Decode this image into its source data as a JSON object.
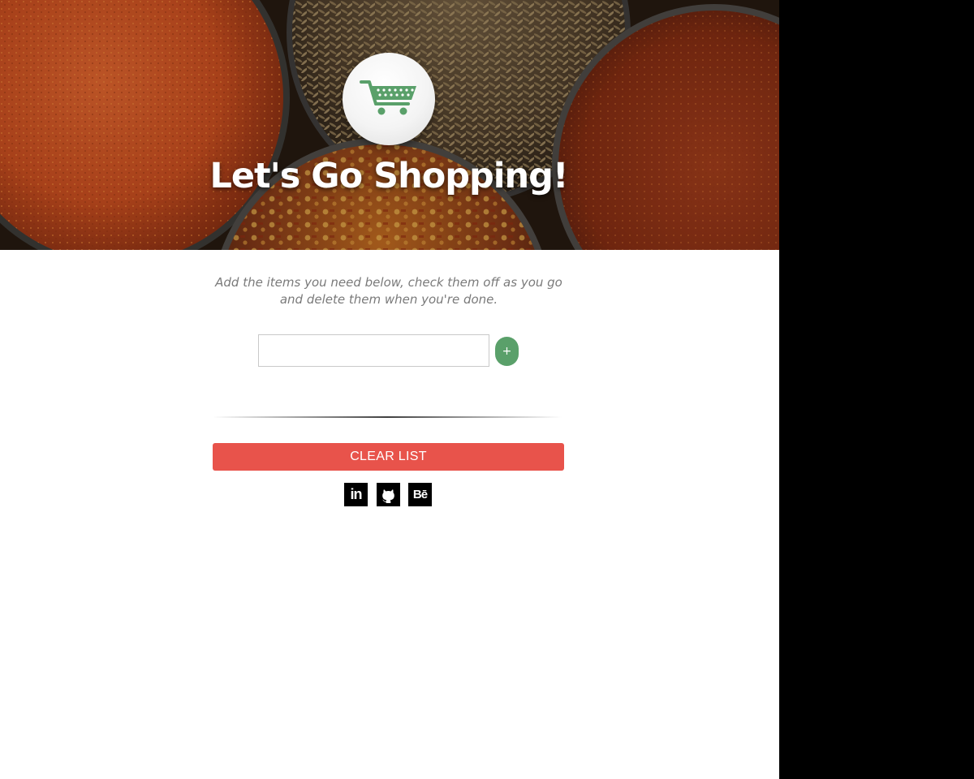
{
  "header": {
    "title": "Let's Go Shopping!",
    "logo_icon": "shopping-cart-icon",
    "logo_color": "#5aa06a"
  },
  "main": {
    "intro": "Add the items you need below, check them off as you go and delete them when you're done.",
    "item_input": {
      "value": "",
      "placeholder": ""
    },
    "add_button_label": "+",
    "clear_button_label": "CLEAR LIST"
  },
  "footer": {
    "social_links": [
      {
        "icon": "linkedin-icon",
        "label": "in"
      },
      {
        "icon": "github-icon",
        "label": ""
      },
      {
        "icon": "behance-icon",
        "label": "Bē"
      }
    ]
  },
  "colors": {
    "accent_green": "#5aa06a",
    "danger_red": "#e8534b",
    "intro_text": "#7a7a7a"
  }
}
